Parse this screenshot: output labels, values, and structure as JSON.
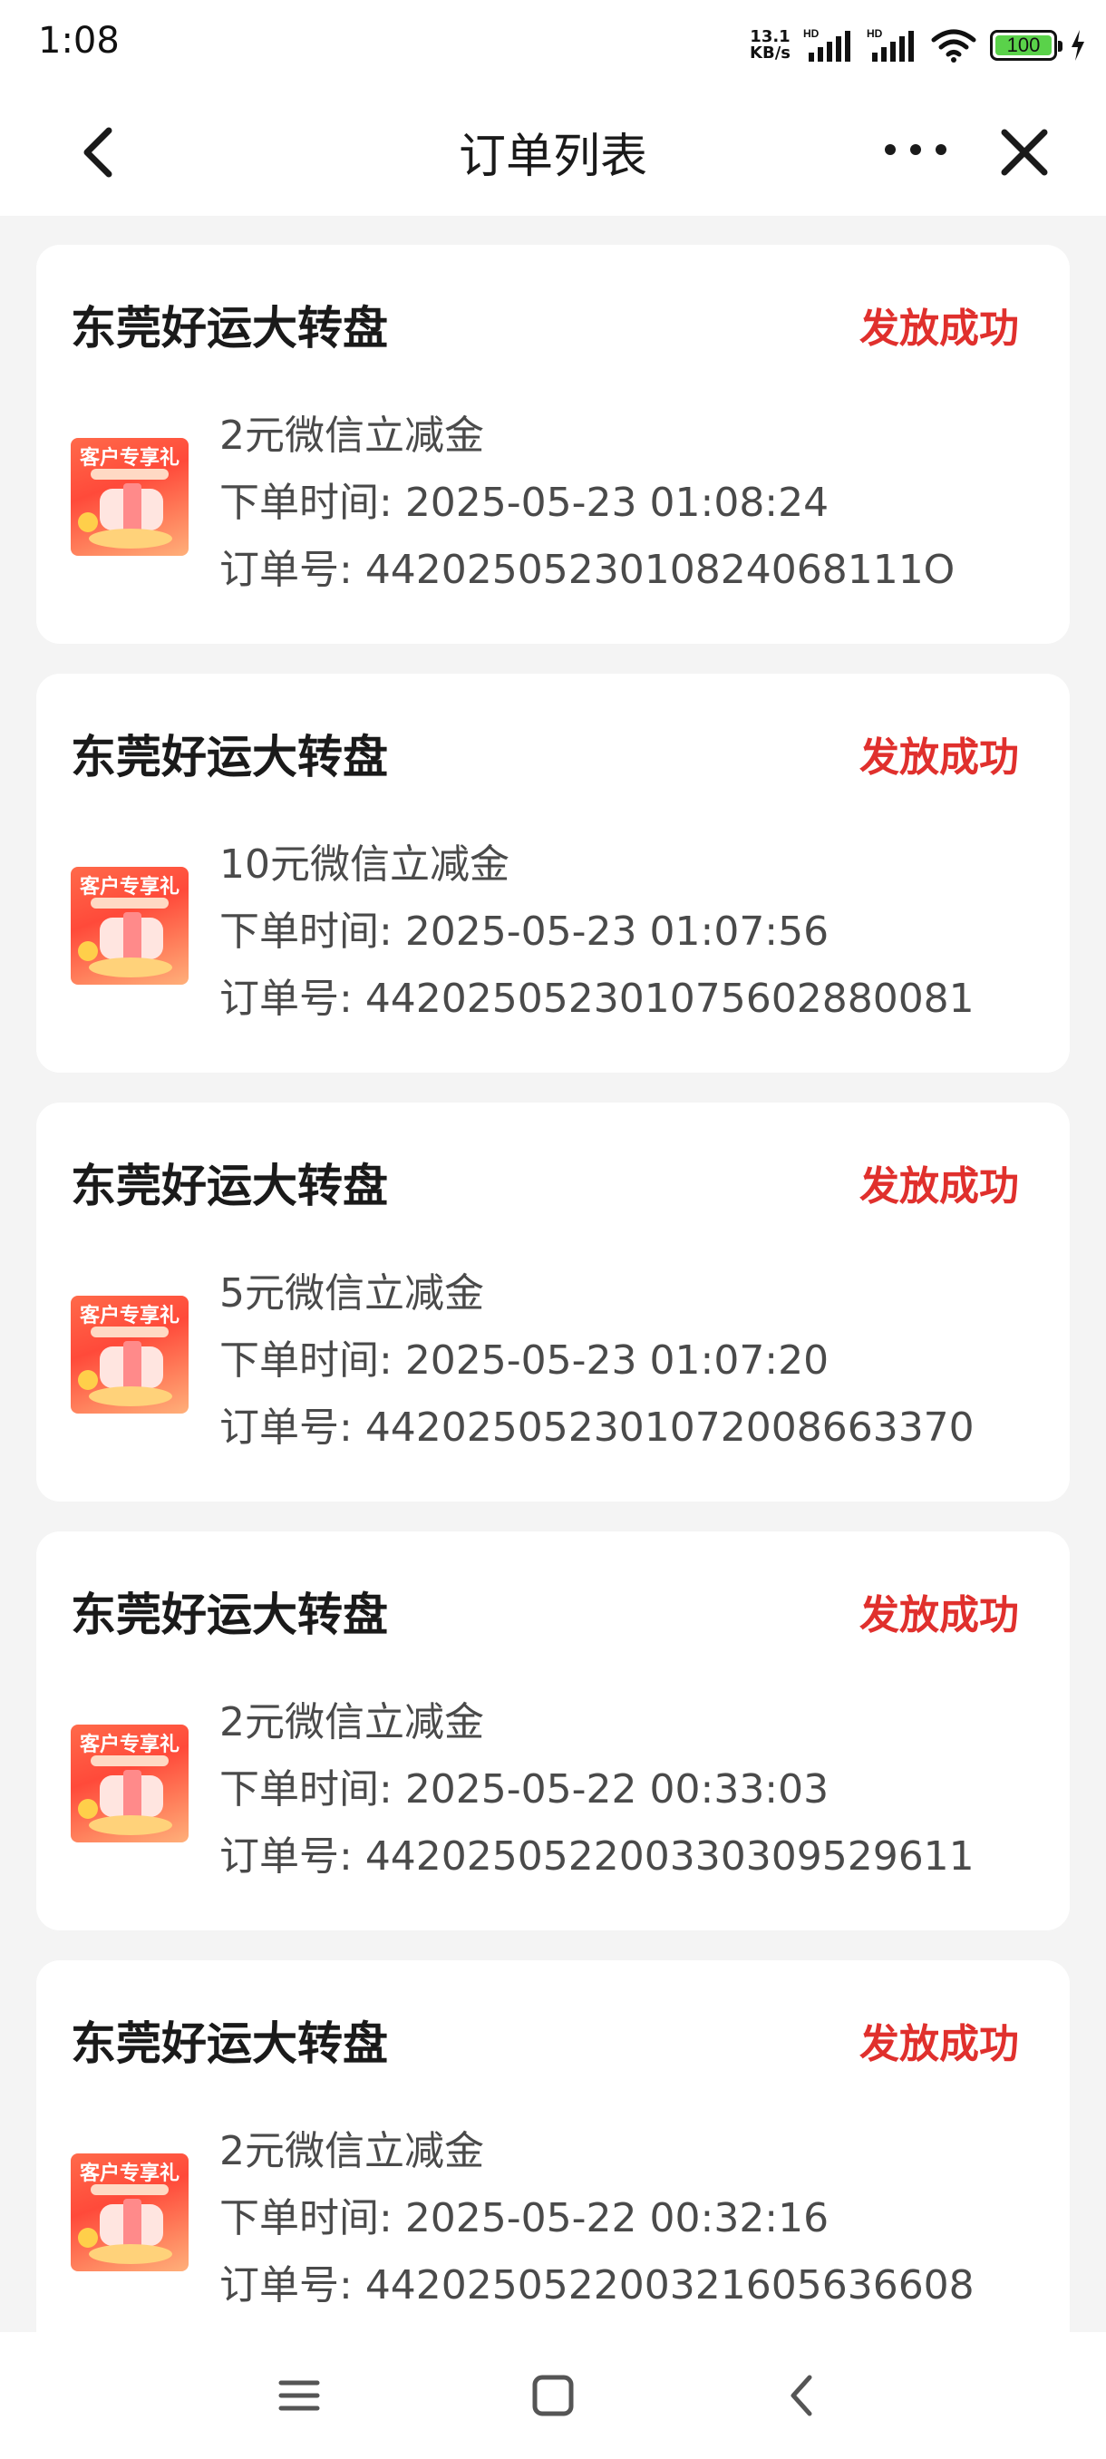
{
  "status_bar": {
    "time": "1:08",
    "net_speed_value": "13.1",
    "net_speed_unit": "KB/s",
    "battery": "100"
  },
  "nav": {
    "title": "订单列表"
  },
  "orders": [
    {
      "title": "东莞好运大转盘",
      "status": "发放成功",
      "thumb_label": "客户专享礼",
      "product": "2元微信立减金",
      "time_label": "下单时间: ",
      "time": "2025-05-23 01:08:24",
      "order_no_label": "订单号: ",
      "order_no": "4420250523010824068111O"
    },
    {
      "title": "东莞好运大转盘",
      "status": "发放成功",
      "thumb_label": "客户专享礼",
      "product": "10元微信立减金",
      "time_label": "下单时间: ",
      "time": "2025-05-23 01:07:56",
      "order_no_label": "订单号: ",
      "order_no": "442025052301075602880081"
    },
    {
      "title": "东莞好运大转盘",
      "status": "发放成功",
      "thumb_label": "客户专享礼",
      "product": "5元微信立减金",
      "time_label": "下单时间: ",
      "time": "2025-05-23 01:07:20",
      "order_no_label": "订单号: ",
      "order_no": "442025052301072008663370"
    },
    {
      "title": "东莞好运大转盘",
      "status": "发放成功",
      "thumb_label": "客户专享礼",
      "product": "2元微信立减金",
      "time_label": "下单时间: ",
      "time": "2025-05-22 00:33:03",
      "order_no_label": "订单号: ",
      "order_no": "442025052200330309529611"
    },
    {
      "title": "东莞好运大转盘",
      "status": "发放成功",
      "thumb_label": "客户专享礼",
      "product": "2元微信立减金",
      "time_label": "下单时间: ",
      "time": "2025-05-22 00:32:16",
      "order_no_label": "订单号: ",
      "order_no": "442025052200321605636608"
    }
  ],
  "colors": {
    "status_success": "#e0302d",
    "page_bg": "#f4f4f4",
    "card_bg": "#ffffff"
  },
  "icons": {
    "back": "chevron-left-icon",
    "more": "more-dots-icon",
    "close": "close-icon",
    "bottom_menu": "menu-lines-icon",
    "bottom_home": "square-home-icon",
    "bottom_back": "back-triangle-icon"
  }
}
